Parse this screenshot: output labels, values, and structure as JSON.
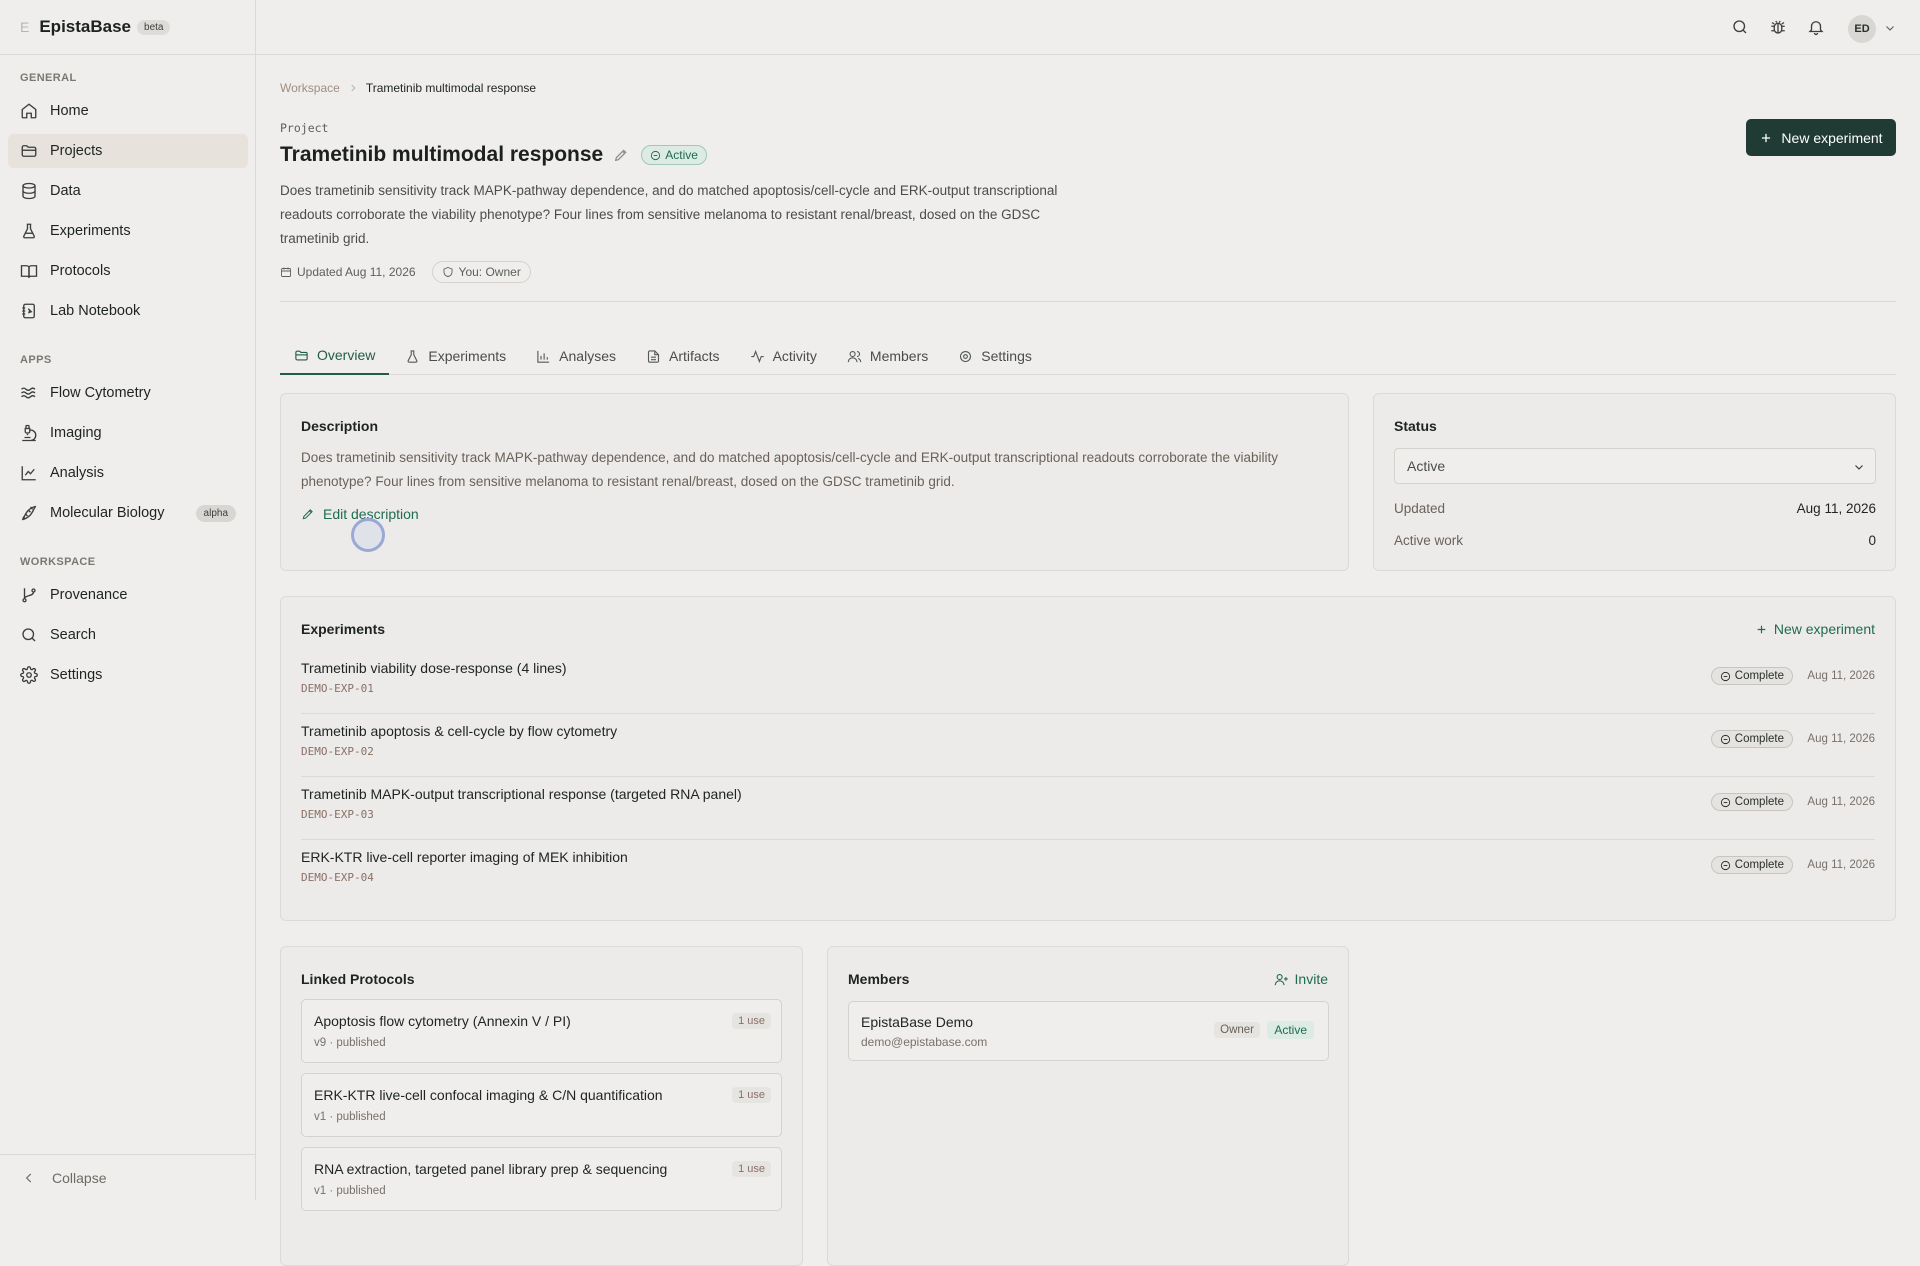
{
  "app": {
    "brand_mark": "E",
    "name": "EpistaBase",
    "badge": "beta"
  },
  "sidebar": {
    "general_title": "GENERAL",
    "general": [
      {
        "label": "Home",
        "icon": "home-icon"
      },
      {
        "label": "Projects",
        "icon": "folder-icon",
        "active": true
      },
      {
        "label": "Data",
        "icon": "database-icon"
      },
      {
        "label": "Experiments",
        "icon": "flask-icon"
      },
      {
        "label": "Protocols",
        "icon": "book-icon"
      },
      {
        "label": "Lab Notebook",
        "icon": "notebook-icon"
      }
    ],
    "apps_title": "APPS",
    "apps": [
      {
        "label": "Flow Cytometry",
        "icon": "waves-icon"
      },
      {
        "label": "Imaging",
        "icon": "microscope-icon"
      },
      {
        "label": "Analysis",
        "icon": "line-chart-icon"
      },
      {
        "label": "Molecular Biology",
        "icon": "dna-icon",
        "badge": "alpha"
      }
    ],
    "workspace_title": "WORKSPACE",
    "workspace": [
      {
        "label": "Provenance",
        "icon": "git-branch-icon"
      },
      {
        "label": "Search",
        "icon": "search-icon"
      },
      {
        "label": "Settings",
        "icon": "gear-icon"
      }
    ],
    "collapse_label": "Collapse"
  },
  "topbar": {
    "avatar_initials": "ED"
  },
  "breadcrumb": {
    "root": "Workspace",
    "current": "Trametinib multimodal response"
  },
  "project": {
    "label": "Project",
    "title": "Trametinib multimodal response",
    "status": "Active",
    "description": "Does trametinib sensitivity track MAPK-pathway dependence, and do matched apoptosis/cell-cycle and ERK-output transcriptional readouts corroborate the viability phenotype? Four lines from sensitive melanoma to resistant renal/breast, dosed on the GDSC trametinib grid.",
    "updated": "Updated Aug 11, 2026",
    "role": "You: Owner",
    "new_experiment_label": "New experiment"
  },
  "tabs": [
    {
      "label": "Overview",
      "icon": "folder-icon",
      "active": true
    },
    {
      "label": "Experiments",
      "icon": "flask-icon"
    },
    {
      "label": "Analyses",
      "icon": "bar-chart-icon"
    },
    {
      "label": "Artifacts",
      "icon": "file-icon"
    },
    {
      "label": "Activity",
      "icon": "activity-icon"
    },
    {
      "label": "Members",
      "icon": "users-icon"
    },
    {
      "label": "Settings",
      "icon": "gear-icon"
    }
  ],
  "description_card": {
    "title": "Description",
    "text": "Does trametinib sensitivity track MAPK-pathway dependence, and do matched apoptosis/cell-cycle and ERK-output transcriptional readouts corroborate the viability phenotype? Four lines from sensitive melanoma to resistant renal/breast, dosed on the GDSC trametinib grid.",
    "edit_label": "Edit description"
  },
  "status_card": {
    "title": "Status",
    "selected": "Active",
    "updated_label": "Updated",
    "updated_value": "Aug 11, 2026",
    "active_work_label": "Active work",
    "active_work_value": "0"
  },
  "experiments_card": {
    "title": "Experiments",
    "new_label": "New experiment",
    "rows": [
      {
        "name": "Trametinib viability dose-response (4 lines)",
        "id": "DEMO-EXP-01",
        "status": "Complete",
        "date": "Aug 11, 2026"
      },
      {
        "name": "Trametinib apoptosis & cell-cycle by flow cytometry",
        "id": "DEMO-EXP-02",
        "status": "Complete",
        "date": "Aug 11, 2026"
      },
      {
        "name": "Trametinib MAPK-output transcriptional response (targeted RNA panel)",
        "id": "DEMO-EXP-03",
        "status": "Complete",
        "date": "Aug 11, 2026"
      },
      {
        "name": "ERK-KTR live-cell reporter imaging of MEK inhibition",
        "id": "DEMO-EXP-04",
        "status": "Complete",
        "date": "Aug 11, 2026"
      }
    ]
  },
  "protocols_card": {
    "title": "Linked Protocols",
    "items": [
      {
        "name": "Apoptosis flow cytometry (Annexin V / PI)",
        "sub": "v9 · published",
        "uses": "1 use"
      },
      {
        "name": "ERK-KTR live-cell confocal imaging & C/N quantification",
        "sub": "v1 · published",
        "uses": "1 use"
      },
      {
        "name": "RNA extraction, targeted panel library prep & sequencing",
        "sub": "v1 · published",
        "uses": "1 use"
      }
    ]
  },
  "members_card": {
    "title": "Members",
    "invite_label": "Invite",
    "member": {
      "name": "EpistaBase Demo",
      "email": "demo@epistabase.com",
      "role": "Owner",
      "status": "Active"
    }
  }
}
